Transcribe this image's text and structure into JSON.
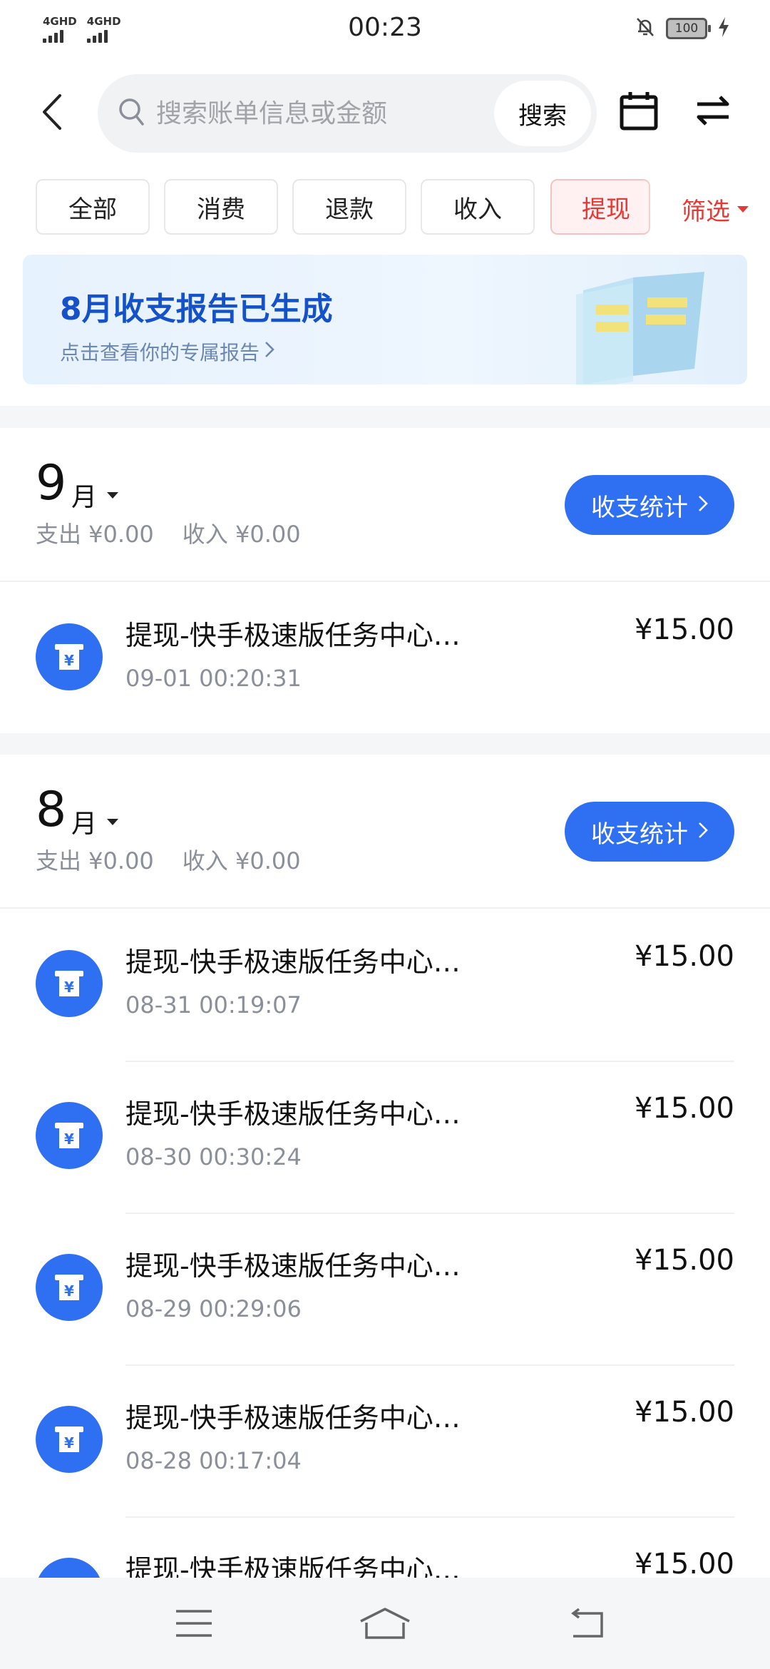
{
  "status_bar": {
    "sim1": "4GHD",
    "sim2": "4GHD",
    "time": "00:23",
    "battery": "100"
  },
  "search": {
    "placeholder": "搜索账单信息或金额",
    "button_label": "搜索"
  },
  "filters": {
    "chips": [
      "全部",
      "消费",
      "退款",
      "收入",
      "提现"
    ],
    "active_index": 4,
    "filter_label": "筛选"
  },
  "banner": {
    "title": "8月收支报告已生成",
    "subtitle": "点击查看你的专属报告"
  },
  "months": [
    {
      "num": "9",
      "unit": "月",
      "expense": "支出 ¥0.00",
      "income": "收入 ¥0.00",
      "stat_label": "收支统计",
      "transactions": [
        {
          "title": "提现-快手极速版任务中心…",
          "time": "09-01 00:20:31",
          "amount": "¥15.00"
        }
      ]
    },
    {
      "num": "8",
      "unit": "月",
      "expense": "支出 ¥0.00",
      "income": "收入 ¥0.00",
      "stat_label": "收支统计",
      "transactions": [
        {
          "title": "提现-快手极速版任务中心…",
          "time": "08-31 00:19:07",
          "amount": "¥15.00"
        },
        {
          "title": "提现-快手极速版任务中心…",
          "time": "08-30 00:30:24",
          "amount": "¥15.00"
        },
        {
          "title": "提现-快手极速版任务中心…",
          "time": "08-29 00:29:06",
          "amount": "¥15.00"
        },
        {
          "title": "提现-快手极速版任务中心…",
          "time": "08-28 00:17:04",
          "amount": "¥15.00"
        },
        {
          "title": "提现-快手极速版任务中心…",
          "time": "",
          "amount": "¥15.00"
        }
      ]
    }
  ],
  "colors": {
    "accent": "#2f6ff1",
    "active_red": "#e53935",
    "banner_title": "#1552c9"
  },
  "icons": {
    "back": "back-arrow-icon",
    "search": "search-icon",
    "calendar": "calendar-icon",
    "switch": "swap-arrows-icon",
    "transaction": "atm-withdraw-icon"
  }
}
